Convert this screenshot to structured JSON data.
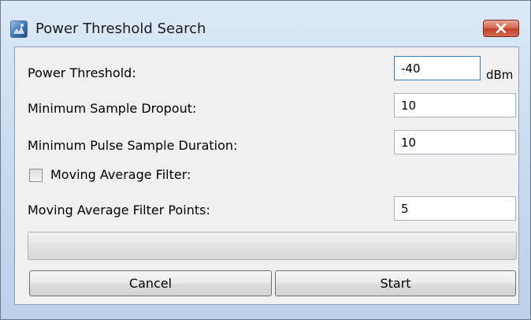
{
  "window": {
    "title": "Power Threshold Search",
    "icon": "app-icon",
    "close_icon": "close-icon"
  },
  "form": {
    "power_threshold": {
      "label": "Power Threshold:",
      "value": "-40",
      "unit": "dBm"
    },
    "min_sample_dropout": {
      "label": "Minimum Sample Dropout:",
      "value": "10"
    },
    "min_pulse_sample_duration": {
      "label": "Minimum Pulse Sample Duration:",
      "value": "10"
    },
    "moving_average_filter": {
      "label": "Moving Average Filter:",
      "checked": false
    },
    "moving_average_filter_points": {
      "label": "Moving Average Filter Points:",
      "value": "5"
    }
  },
  "progress": {
    "value": 0
  },
  "buttons": {
    "cancel": "Cancel",
    "start": "Start"
  },
  "colors": {
    "close_button": "#c8452f",
    "progress_fill": "#3fbf3a"
  }
}
